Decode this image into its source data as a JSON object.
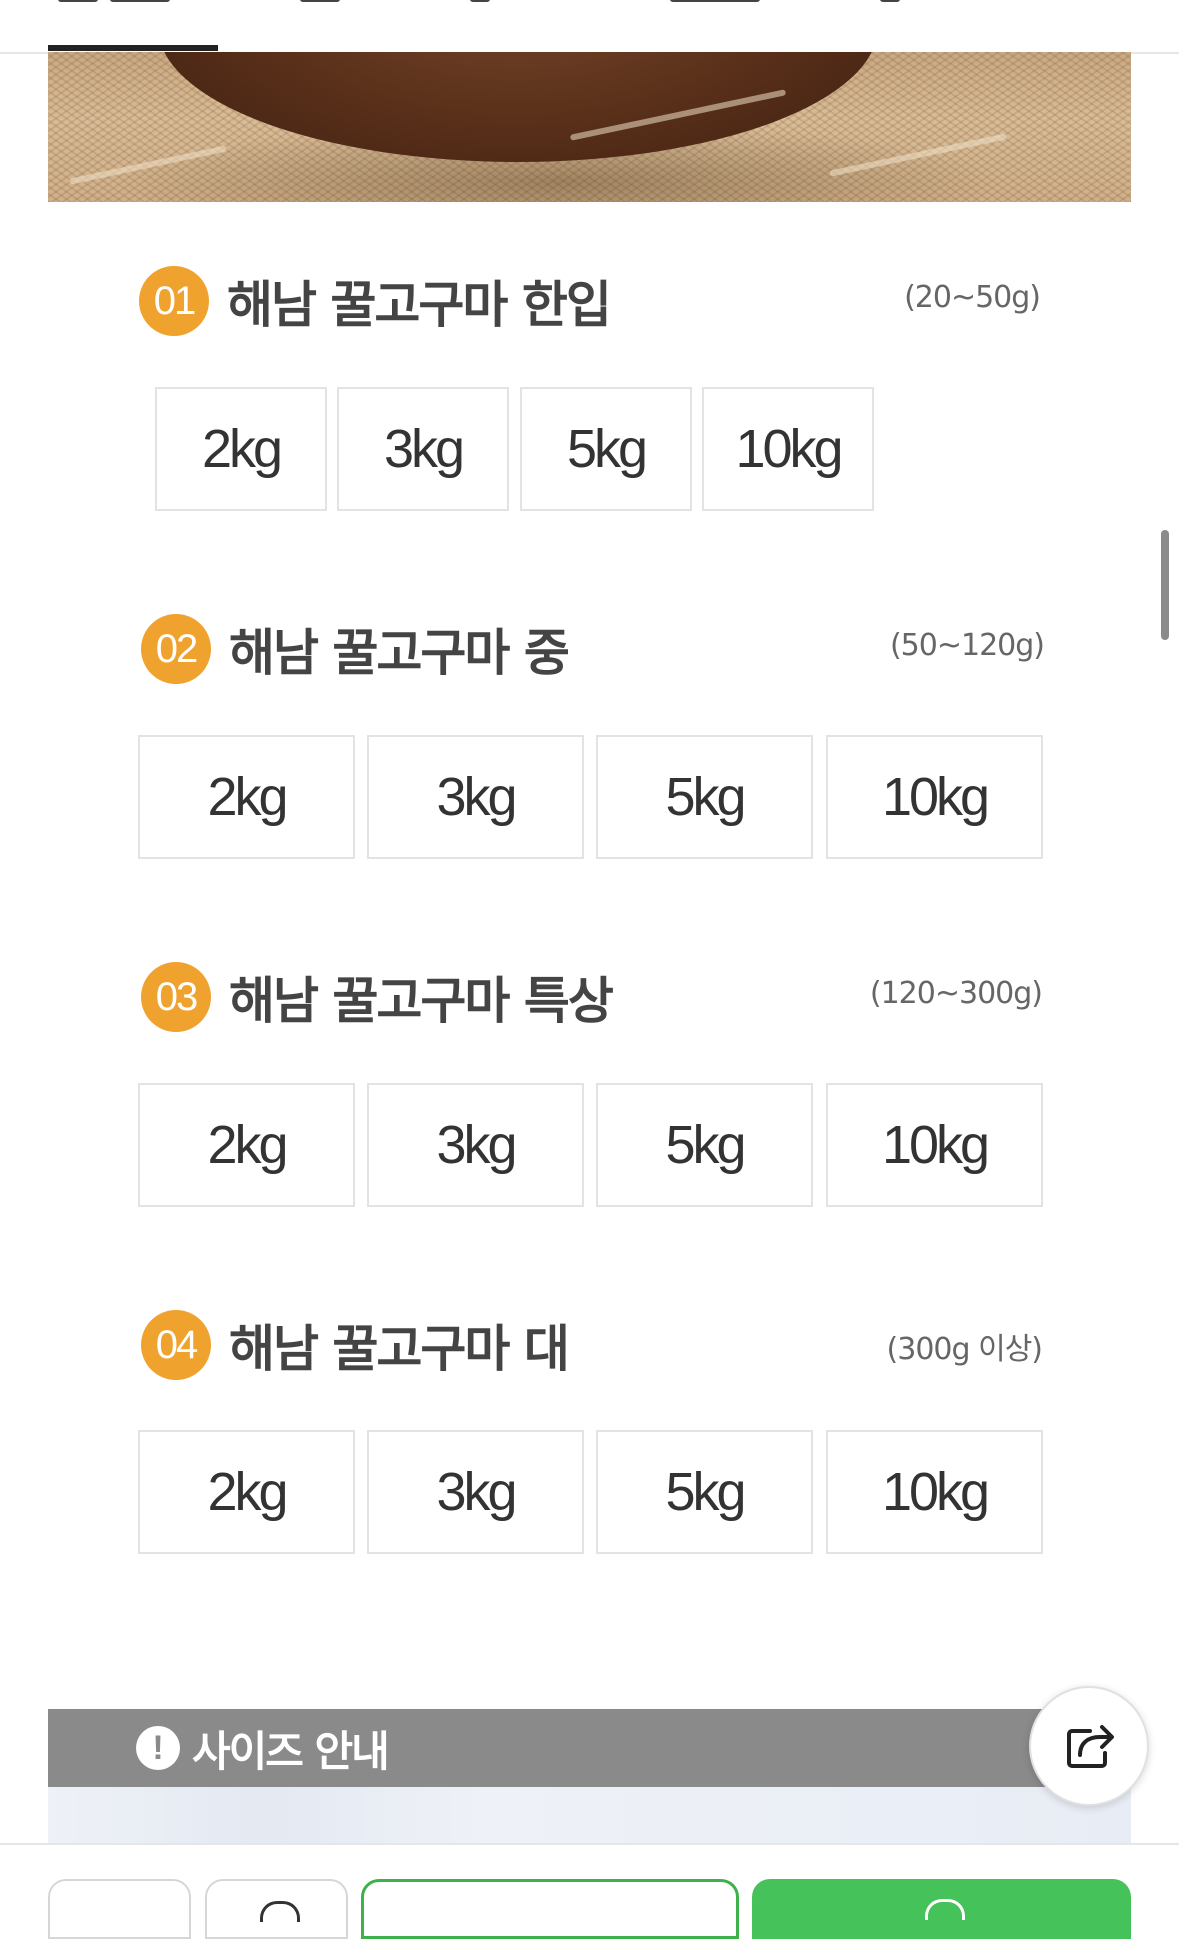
{
  "sections": [
    {
      "number": "01",
      "title": "해남 꿀고구마 한입",
      "range": "(20~50g)",
      "options": [
        "2kg",
        "3kg",
        "5kg",
        "10kg"
      ]
    },
    {
      "number": "02",
      "title": "해남 꿀고구마 중",
      "range": "(50~120g)",
      "options": [
        "2kg",
        "3kg",
        "5kg",
        "10kg"
      ]
    },
    {
      "number": "03",
      "title": "해남 꿀고구마 특상",
      "range": "(120~300g)",
      "options": [
        "2kg",
        "3kg",
        "5kg",
        "10kg"
      ]
    },
    {
      "number": "04",
      "title": "해남 꿀고구마 대",
      "range": "(300g 이상)",
      "options": [
        "2kg",
        "3kg",
        "5kg",
        "10kg"
      ]
    }
  ],
  "notice": {
    "label": "사이즈 안내",
    "icon": "exclamation-icon"
  },
  "share": {
    "icon": "share-icon"
  },
  "colors": {
    "badge": "#f0a22e",
    "notice_bar": "#8a8a8a",
    "buy_green": "#46c25a"
  }
}
